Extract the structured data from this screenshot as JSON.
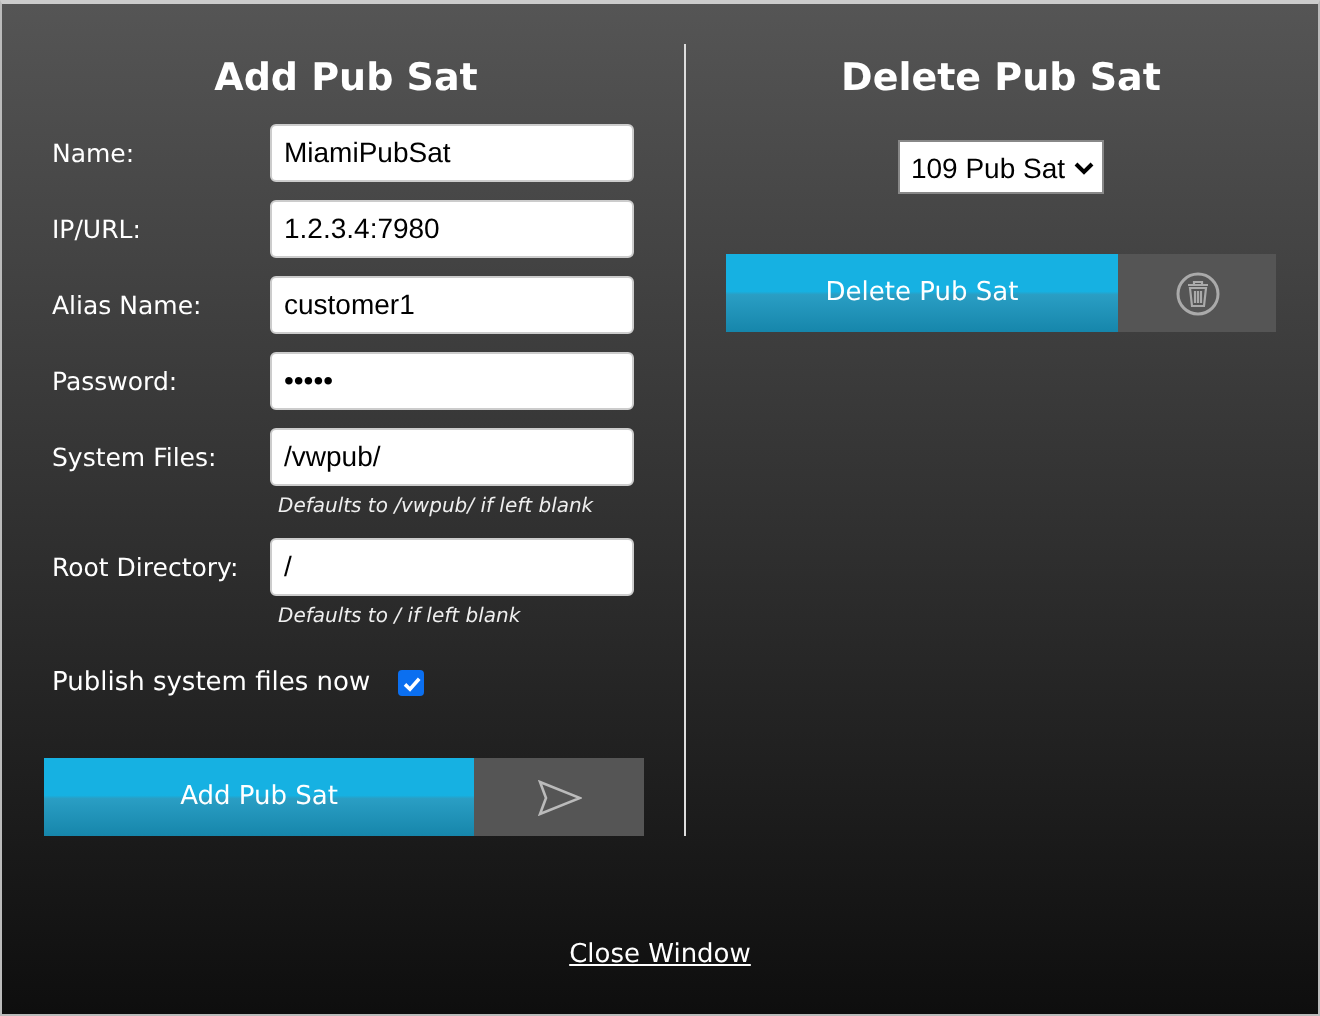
{
  "add_panel": {
    "title": "Add Pub Sat",
    "fields": [
      {
        "label": "Name:",
        "value": "MiamiPubSat"
      },
      {
        "label": "IP/URL:",
        "value": "1.2.3.4:7980"
      },
      {
        "label": "Alias Name:",
        "value": "customer1"
      },
      {
        "label": "Password:",
        "value": "•••••"
      },
      {
        "label": "System Files:",
        "value": "/vwpub/",
        "hint": "Defaults to /vwpub/ if left blank"
      },
      {
        "label": "Root Directory:",
        "value": "/",
        "hint": "Defaults to / if left blank"
      }
    ],
    "publish_checkbox": {
      "label": "Publish system files now",
      "checked": true
    },
    "submit_button": "Add Pub Sat"
  },
  "delete_panel": {
    "title": "Delete Pub Sat",
    "select": "109 Pub Sat",
    "delete_button": "Delete Pub Sat"
  },
  "close_link": "Close Window"
}
